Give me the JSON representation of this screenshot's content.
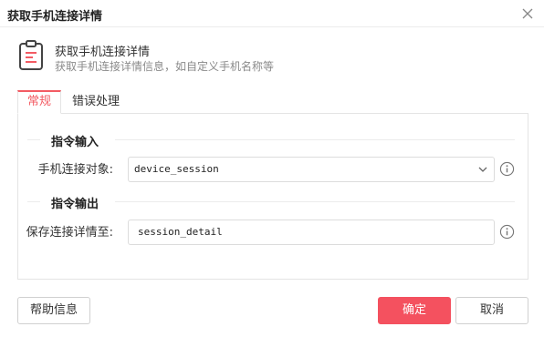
{
  "window": {
    "title": "获取手机连接详情"
  },
  "header": {
    "icon": "clipboard-icon",
    "title": "获取手机连接详情",
    "description": "获取手机连接详情信息，如自定义手机名称等"
  },
  "tabs": [
    {
      "label": "常规",
      "active": true
    },
    {
      "label": "错误处理",
      "active": false
    }
  ],
  "sections": {
    "input": {
      "title": "指令输入",
      "label": "手机连接对象:",
      "value": "device_session"
    },
    "output": {
      "title": "指令输出",
      "label": "保存连接详情至:",
      "value": "session_detail"
    }
  },
  "buttons": {
    "help": "帮助信息",
    "ok": "确定",
    "cancel": "取消"
  },
  "colors": {
    "accent": "#f4515f"
  }
}
